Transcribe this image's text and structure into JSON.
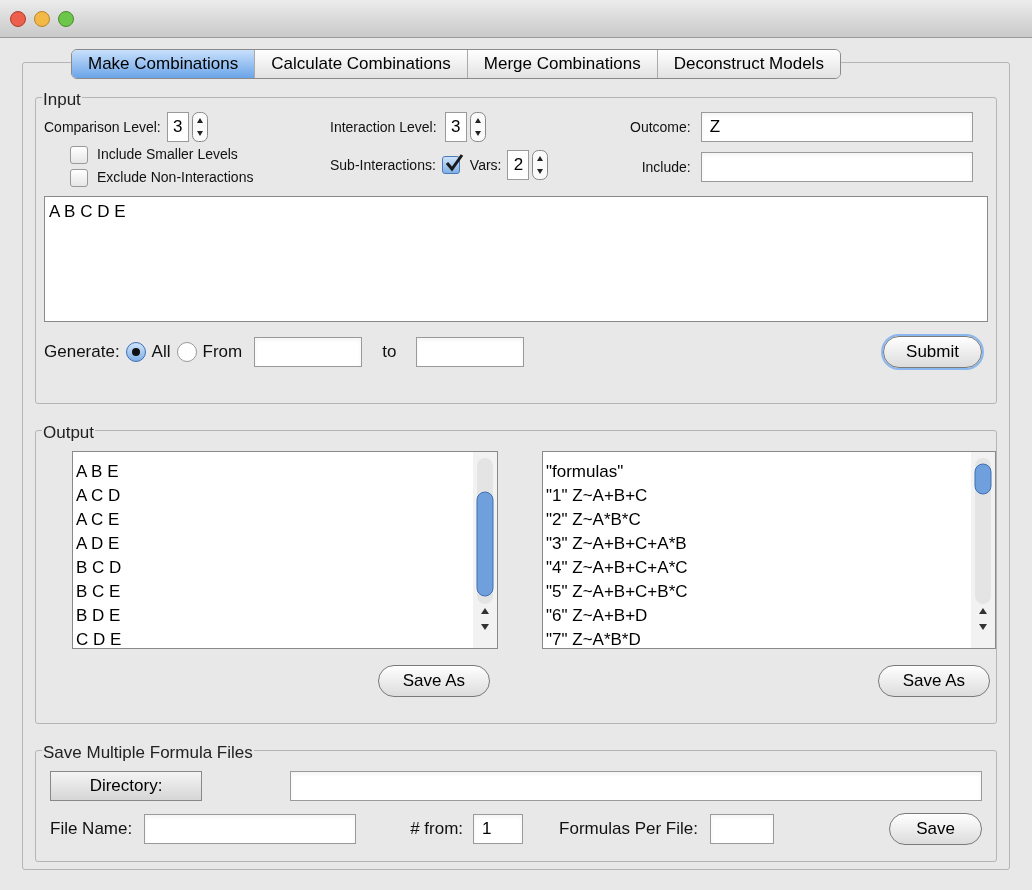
{
  "tabs": [
    {
      "label": "Make Combinations",
      "selected": true
    },
    {
      "label": "Calculate Combinations",
      "selected": false
    },
    {
      "label": "Merge Combinations",
      "selected": false
    },
    {
      "label": "Deconstruct Models",
      "selected": false
    }
  ],
  "input": {
    "title": "Input",
    "comparison_level": {
      "label": "Comparison Level:",
      "value": "3"
    },
    "include_smaller": {
      "label": "Include Smaller Levels",
      "checked": false
    },
    "exclude_non": {
      "label": "Exclude Non-Interactions",
      "checked": false
    },
    "interaction_level": {
      "label": "Interaction Level:",
      "value": "3"
    },
    "sub_interactions": {
      "label": "Sub-Interactions:",
      "checked": true
    },
    "vars": {
      "label": "Vars:",
      "value": "2"
    },
    "outcome": {
      "label": "Outcome:",
      "value": "Z"
    },
    "include": {
      "label": "Include:"
    },
    "variables": "A B C D E",
    "generate": {
      "label": "Generate:",
      "options": [
        {
          "label": "All",
          "selected": true
        },
        {
          "label": "From",
          "selected": false
        }
      ],
      "to_label": "to"
    },
    "submit": "Submit"
  },
  "output": {
    "title": "Output",
    "left_list": [
      "A B E",
      "A C D",
      "A C E",
      "A D E",
      "B C D",
      "B C E",
      "B D E",
      "C D E"
    ],
    "right_list": [
      "\"formulas\"",
      "\"1\" Z~A+B+C",
      "\"2\" Z~A*B*C",
      "\"3\" Z~A+B+C+A*B",
      "\"4\" Z~A+B+C+A*C",
      "\"5\" Z~A+B+C+B*C",
      "\"6\" Z~A+B+D",
      "\"7\" Z~A*B*D"
    ],
    "left_save": "Save As",
    "right_save": "Save As"
  },
  "save_multiple": {
    "title": "Save Multiple Formula Files",
    "directory": "Directory:",
    "file_name": "File Name:",
    "from": {
      "label": "# from:",
      "value": "1"
    },
    "per_file": "Formulas Per File:",
    "save": "Save"
  }
}
